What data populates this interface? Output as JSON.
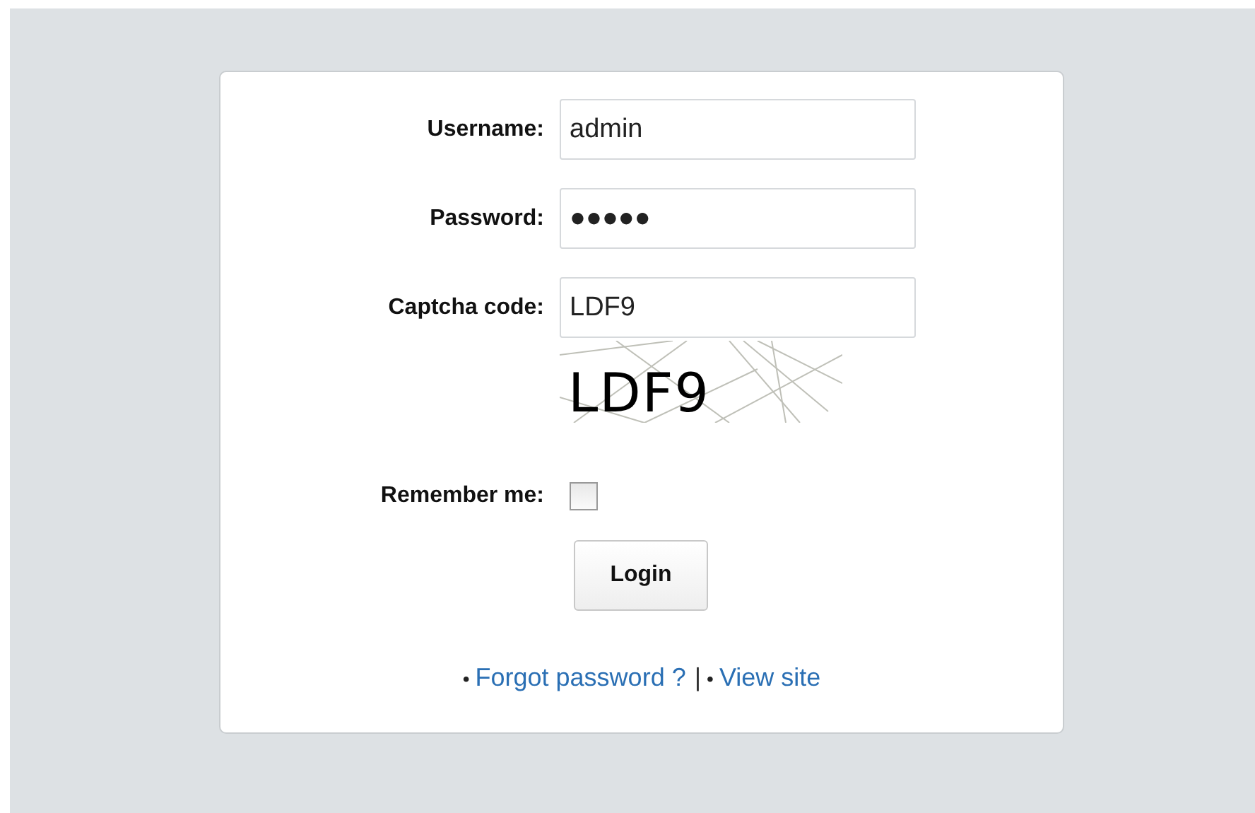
{
  "fields": [
    {
      "label": "Username:",
      "value": "admin"
    },
    {
      "label": "Password:",
      "value": "●●●●●"
    },
    {
      "label": "Captcha code:",
      "value": "LDF9"
    }
  ],
  "captcha": {
    "code": "LDF9"
  },
  "remember": {
    "label": "Remember me:",
    "checked": false
  },
  "login_button": "Login",
  "links": [
    {
      "bullet": "•",
      "text": "Forgot password ?"
    },
    {
      "separator": "|",
      "bullet": "•",
      "text": "View site"
    }
  ]
}
